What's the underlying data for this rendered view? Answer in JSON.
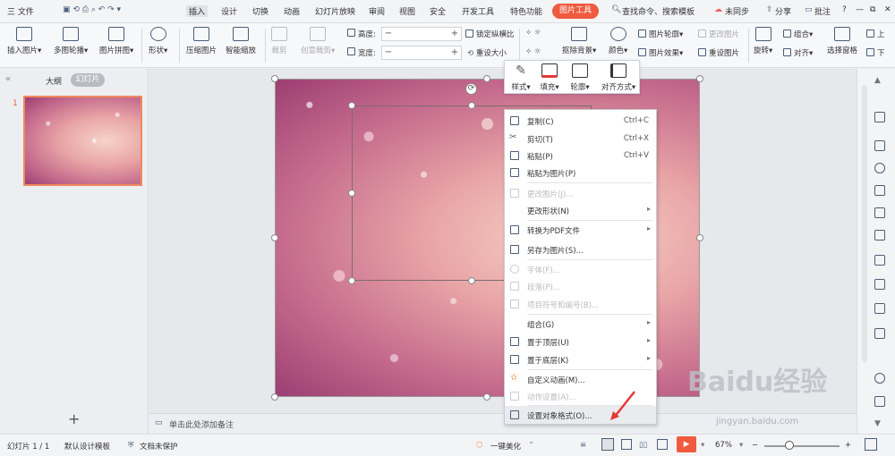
{
  "titlebar": {
    "file_menu": "三 文件",
    "tabs": [
      "插入",
      "设计",
      "切换",
      "动画",
      "幻灯片放映",
      "审阅",
      "视图",
      "安全",
      "开发工具",
      "特色功能"
    ],
    "active_tab": "图片工具",
    "search": "查找命令、搜索模板",
    "sync": "未同步",
    "share": "分享",
    "comment": "批注",
    "help": "?",
    "window_controls": [
      "—",
      "⧉",
      "✕"
    ]
  },
  "ribbon": {
    "insert_picture": "插入图片",
    "multi_outline": "多图轮播",
    "picture_collage": "图片拼图",
    "shape": "形状",
    "compress": "压缩图片",
    "smart_zoom": "智能缩放",
    "crop": "裁剪",
    "creative_crop": "创意裁剪",
    "height_label": "高度:",
    "width_label": "宽度:",
    "minus": "−",
    "plus": "+",
    "lock_ratio": "锁定纵横比",
    "reset_size": "重设大小",
    "remove_bg": "抠除背景",
    "color": "颜色",
    "picture_outline": "图片轮廓",
    "picture_effect": "图片效果",
    "change_picture": "更改图片",
    "reset_picture": "重设图片",
    "rotate": "旋转",
    "group": "组合",
    "align": "对齐",
    "selection_pane": "选择窗格",
    "up": "上",
    "down": "下"
  },
  "left_panel": {
    "tab_outline": "大纲",
    "tab_slides": "幻灯片",
    "slide_number": "1",
    "add_slide": "+"
  },
  "notes_placeholder": "单击此处添加备注",
  "mini_toolbar": {
    "style": "样式",
    "fill": "填充",
    "outline": "轮廓",
    "align": "对齐方式"
  },
  "context_menu": [
    {
      "label": "复制(C)",
      "shortcut": "Ctrl+C",
      "disabled": false,
      "icon": "copy-icon"
    },
    {
      "label": "剪切(T)",
      "shortcut": "Ctrl+X",
      "disabled": false,
      "icon": "cut-icon"
    },
    {
      "label": "粘贴(P)",
      "shortcut": "Ctrl+V",
      "disabled": false,
      "icon": "paste-icon"
    },
    {
      "label": "粘贴为图片(P)",
      "shortcut": "",
      "disabled": false,
      "icon": "paste-image-icon"
    },
    {
      "label": "更改图片(J)...",
      "shortcut": "",
      "disabled": true,
      "icon": "change-picture-icon"
    },
    {
      "label": "更改形状(N)",
      "shortcut": "",
      "disabled": false,
      "submenu": true,
      "icon": ""
    },
    {
      "label": "转换为PDF文件",
      "shortcut": "",
      "disabled": false,
      "submenu": true,
      "icon": "pdf-icon"
    },
    {
      "label": "另存为图片(S)...",
      "shortcut": "",
      "disabled": false,
      "icon": "save-image-icon"
    },
    {
      "label": "字体(F)...",
      "shortcut": "",
      "disabled": true,
      "icon": "font-icon"
    },
    {
      "label": "段落(P)...",
      "shortcut": "",
      "disabled": true,
      "icon": "paragraph-icon"
    },
    {
      "label": "项目符号和编号(B)...",
      "shortcut": "",
      "disabled": true,
      "icon": "bullets-icon"
    },
    {
      "label": "组合(G)",
      "shortcut": "",
      "disabled": false,
      "submenu": true,
      "icon": ""
    },
    {
      "label": "置于顶层(U)",
      "shortcut": "",
      "disabled": false,
      "submenu": true,
      "icon": "bring-front-icon"
    },
    {
      "label": "置于底层(K)",
      "shortcut": "",
      "disabled": false,
      "submenu": true,
      "icon": "send-back-icon"
    },
    {
      "label": "自定义动画(M)...",
      "shortcut": "",
      "disabled": false,
      "icon": "animation-icon"
    },
    {
      "label": "动作设置(A)...",
      "shortcut": "",
      "disabled": true,
      "icon": "action-icon"
    },
    {
      "label": "设置对象格式(O)...",
      "shortcut": "",
      "disabled": false,
      "highlight": true,
      "icon": "format-icon"
    }
  ],
  "status": {
    "slide_info": "幻灯片 1 / 1",
    "template": "默认设计模板",
    "protect": "文档未保护",
    "beautify": "一键美化",
    "zoom": "67%",
    "zoom_minus": "−",
    "zoom_plus": "+"
  },
  "watermark": {
    "logo": "Baidu经验",
    "url": "jingyan.baidu.com"
  },
  "colors": {
    "accent": "#f05a3e",
    "thumb_border": "#f08a5d",
    "arrow": "#e53935"
  }
}
